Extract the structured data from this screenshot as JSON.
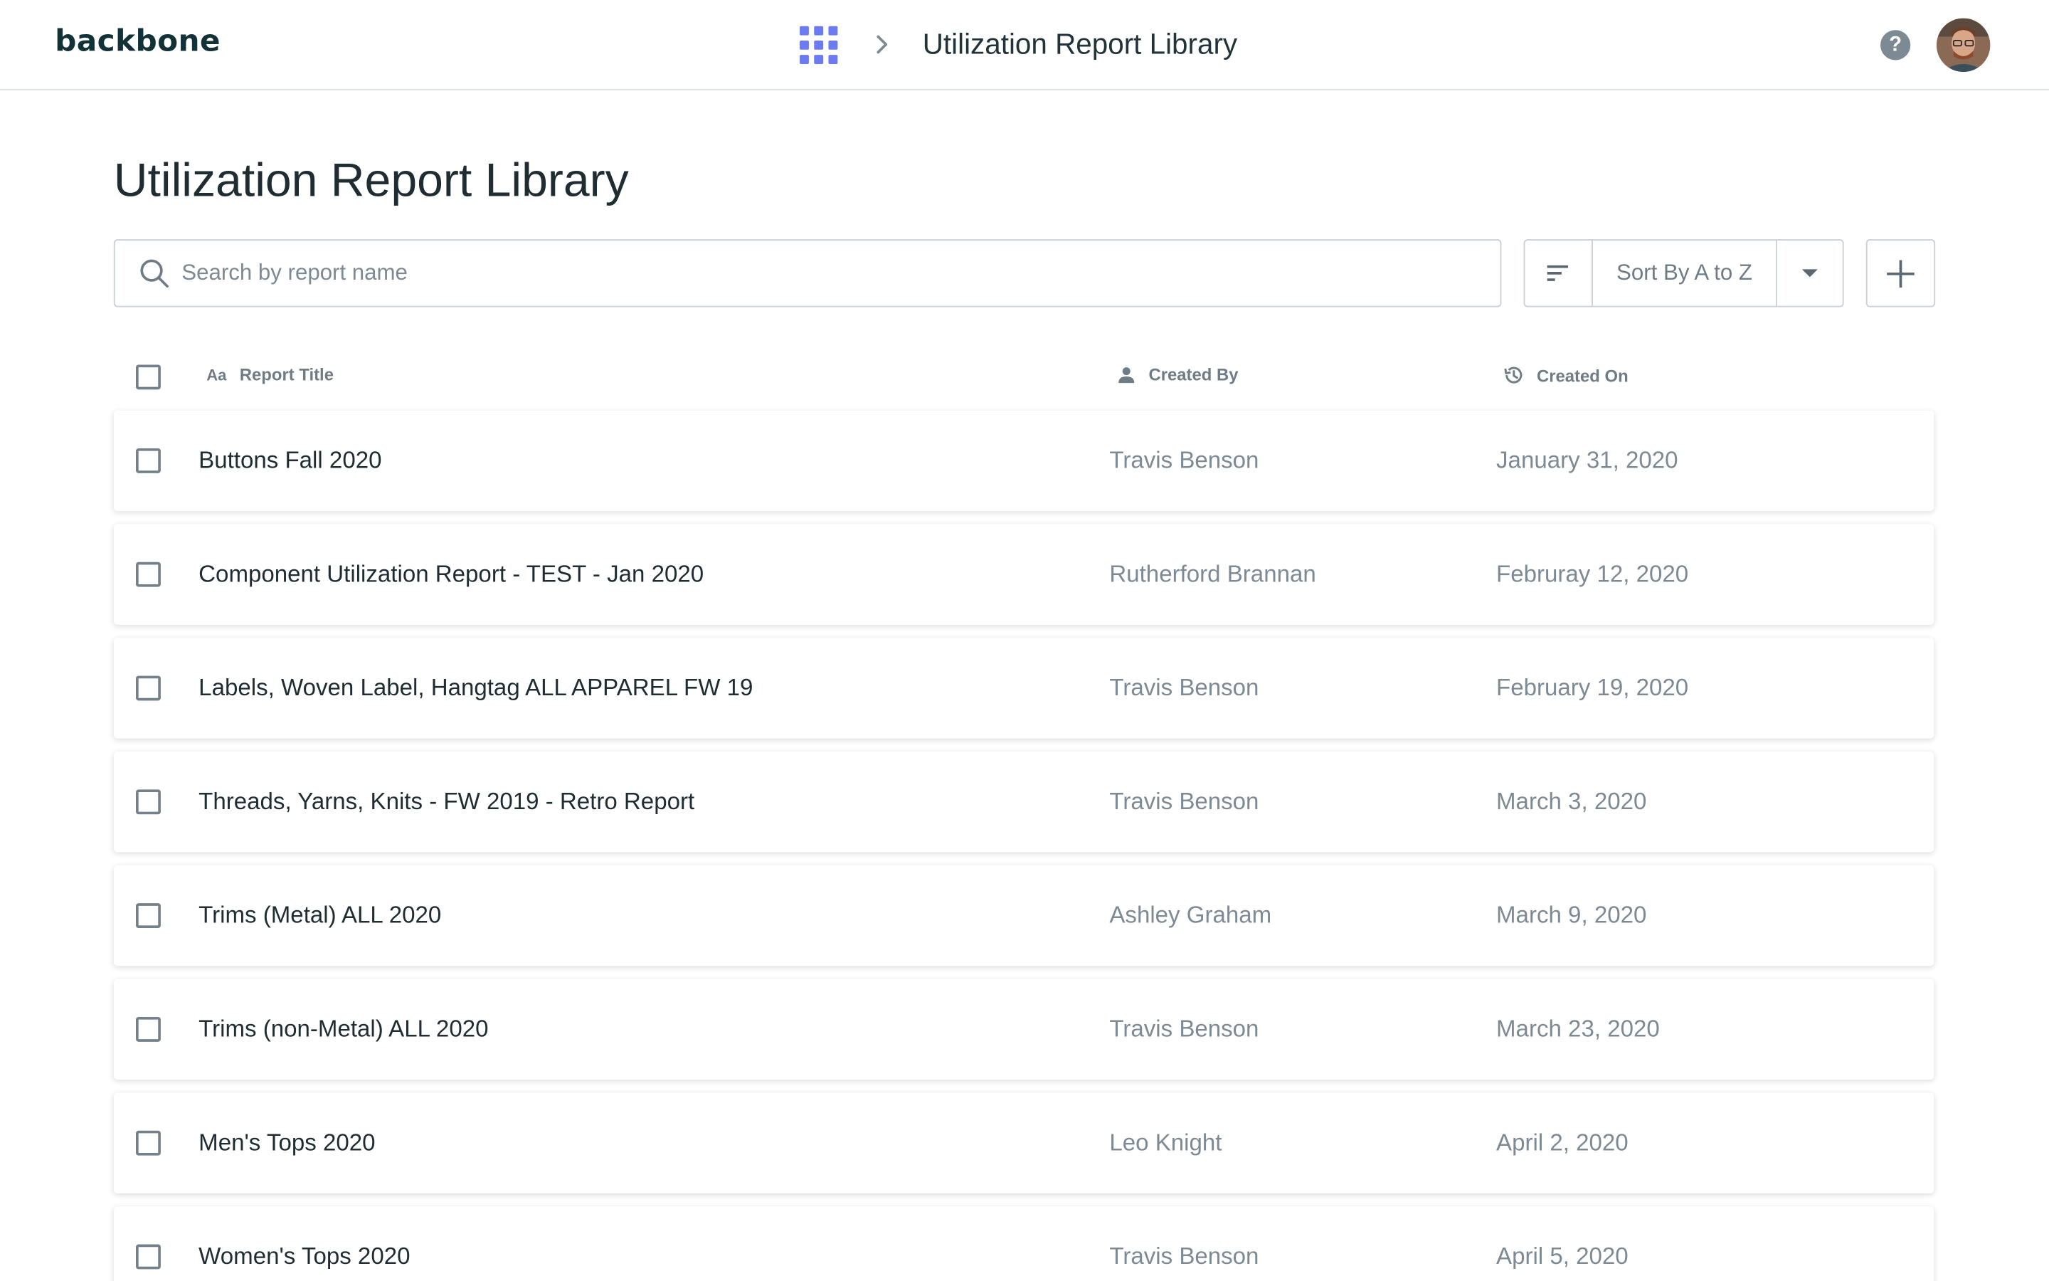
{
  "topbar": {
    "logo": "backbone",
    "breadcrumb_title": "Utilization Report Library"
  },
  "page": {
    "title": "Utilization Report Library"
  },
  "toolbar": {
    "search_placeholder": "Search by report name",
    "search_value": "",
    "sort_label": "Sort By A to Z"
  },
  "table": {
    "columns": {
      "title_icon": "Aa",
      "title": "Report Title",
      "created_by": "Created By",
      "created_on": "Created On"
    },
    "rows": [
      {
        "title": "Buttons Fall 2020",
        "created_by": "Travis Benson",
        "created_on": "January 31, 2020",
        "checked": false
      },
      {
        "title": "Component Utilization Report - TEST - Jan 2020",
        "created_by": "Rutherford Brannan",
        "created_on": "Februray 12, 2020",
        "checked": false
      },
      {
        "title": "Labels, Woven Label, Hangtag ALL APPAREL FW 19",
        "created_by": "Travis Benson",
        "created_on": "February 19, 2020",
        "checked": false
      },
      {
        "title": "Threads, Yarns, Knits - FW 2019 - Retro Report",
        "created_by": "Travis Benson",
        "created_on": "March 3, 2020",
        "checked": false
      },
      {
        "title": "Trims (Metal) ALL 2020",
        "created_by": "Ashley Graham",
        "created_on": "March 9, 2020",
        "checked": false
      },
      {
        "title": "Trims (non-Metal) ALL 2020",
        "created_by": "Travis Benson",
        "created_on": "March 23, 2020",
        "checked": false
      },
      {
        "title": "Men's Tops 2020",
        "created_by": "Leo Knight",
        "created_on": "April 2, 2020",
        "checked": false
      },
      {
        "title": "Women's Tops 2020",
        "created_by": "Travis Benson",
        "created_on": "April 5, 2020",
        "checked": false
      }
    ]
  },
  "colors": {
    "accent": "#6c7bf0",
    "text_primary": "#1f2d33",
    "text_secondary": "#7d8a93",
    "border": "#c9d0d4"
  },
  "icons": {
    "apps": "apps-grid-icon",
    "breadcrumb_separator": "chevron-right-icon",
    "help": "help-circle-icon",
    "search": "search-icon",
    "sort": "sort-lines-icon",
    "dropdown": "caret-down-icon",
    "add": "plus-icon",
    "created_by": "person-icon",
    "created_on": "history-icon"
  }
}
